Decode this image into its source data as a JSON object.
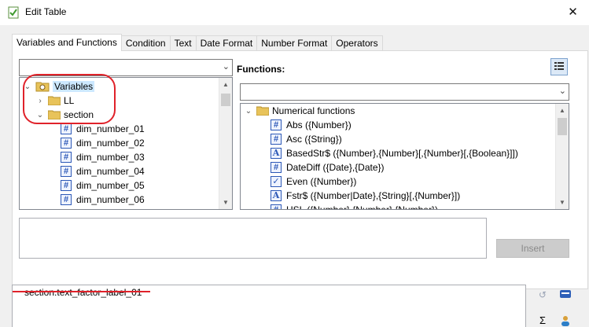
{
  "window": {
    "title": "Edit Table",
    "close_glyph": "✕"
  },
  "tabs": [
    {
      "label": "Variables and Functions",
      "active": true
    },
    {
      "label": "Condition",
      "active": false
    },
    {
      "label": "Text",
      "active": false
    },
    {
      "label": "Date Format",
      "active": false
    },
    {
      "label": "Number Format",
      "active": false
    },
    {
      "label": "Operators",
      "active": false
    }
  ],
  "variables": {
    "combo_value": "",
    "tree": [
      {
        "label": "Variables",
        "level": 0,
        "expander": "collapse",
        "icon": "variables-icon",
        "selected": true
      },
      {
        "label": "LL",
        "level": 1,
        "expander": "expand",
        "icon": "folder-icon"
      },
      {
        "label": "section",
        "level": 1,
        "expander": "collapse",
        "icon": "folder-icon"
      },
      {
        "label": "dim_number_01",
        "level": 2,
        "expander": "none",
        "icon": "number-icon"
      },
      {
        "label": "dim_number_02",
        "level": 2,
        "expander": "none",
        "icon": "number-icon"
      },
      {
        "label": "dim_number_03",
        "level": 2,
        "expander": "none",
        "icon": "number-icon"
      },
      {
        "label": "dim_number_04",
        "level": 2,
        "expander": "none",
        "icon": "number-icon"
      },
      {
        "label": "dim_number_05",
        "level": 2,
        "expander": "none",
        "icon": "number-icon"
      },
      {
        "label": "dim_number_06",
        "level": 2,
        "expander": "none",
        "icon": "number-icon"
      }
    ]
  },
  "functions": {
    "label": "Functions:",
    "combo_value": "",
    "tree": [
      {
        "label": "Numerical functions",
        "level": 0,
        "expander": "collapse",
        "icon": "folder-icon"
      },
      {
        "label": "Abs ({Number})",
        "level": 1,
        "icon": "number-icon"
      },
      {
        "label": "Asc ({String})",
        "level": 1,
        "icon": "number-icon"
      },
      {
        "label": "BasedStr$ ({Number},{Number}[,{Number}[,{Boolean}]])",
        "level": 1,
        "icon": "string-icon"
      },
      {
        "label": "DateDiff ({Date},{Date})",
        "level": 1,
        "icon": "number-icon"
      },
      {
        "label": "Even ({Number})",
        "level": 1,
        "icon": "boolean-icon"
      },
      {
        "label": "Fstr$ ({Number|Date},{String}[,{Number}])",
        "level": 1,
        "icon": "string-icon"
      },
      {
        "label": "HSL ({Number},{Number},{Number})",
        "level": 1,
        "icon": "number-icon"
      }
    ]
  },
  "insert_button": "Insert",
  "expression": {
    "value": "section.text_factor_label_01"
  },
  "side_icons": [
    "wrap-icon",
    "keyboard-icon",
    "sum-icon",
    "users-icon"
  ]
}
